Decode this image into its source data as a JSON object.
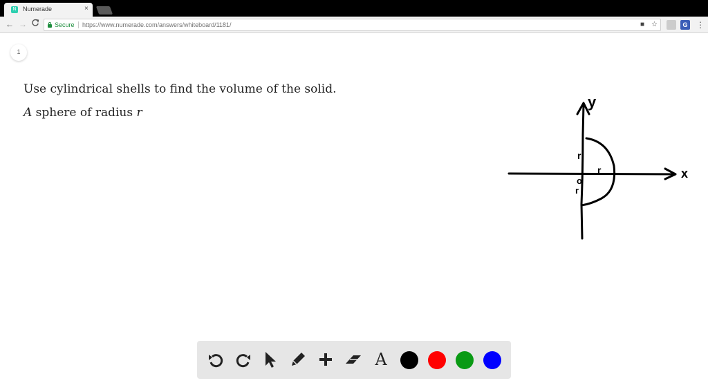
{
  "browser": {
    "tab_title": "Numerade",
    "tab_favicon_text": "N",
    "tab_close": "×",
    "secure_label": "Secure",
    "url": "https://www.numerade.com/answers/whiteboard/1181/",
    "ext_badge": "G"
  },
  "icons": {
    "back": "←",
    "forward": "→",
    "reload": "C",
    "camera": "■",
    "star": "☆",
    "menu": "⋮"
  },
  "whiteboard": {
    "page_number": "1",
    "question_line1": "Use cylindrical shells to find the volume of the solid.",
    "question_line2_var": "A",
    "question_line2_text": " sphere of radius ",
    "question_line2_radius": "r"
  },
  "sketch_labels": {
    "y_axis": "y",
    "x_axis": "x",
    "r_top": "r",
    "r_middle": "r",
    "r_bottom": "r",
    "o_mark": "o"
  },
  "palette": {
    "text_tool": "A",
    "colors": {
      "black": "#000000",
      "red": "#ff0000",
      "green": "#0a9a14",
      "blue": "#0000ff"
    }
  }
}
